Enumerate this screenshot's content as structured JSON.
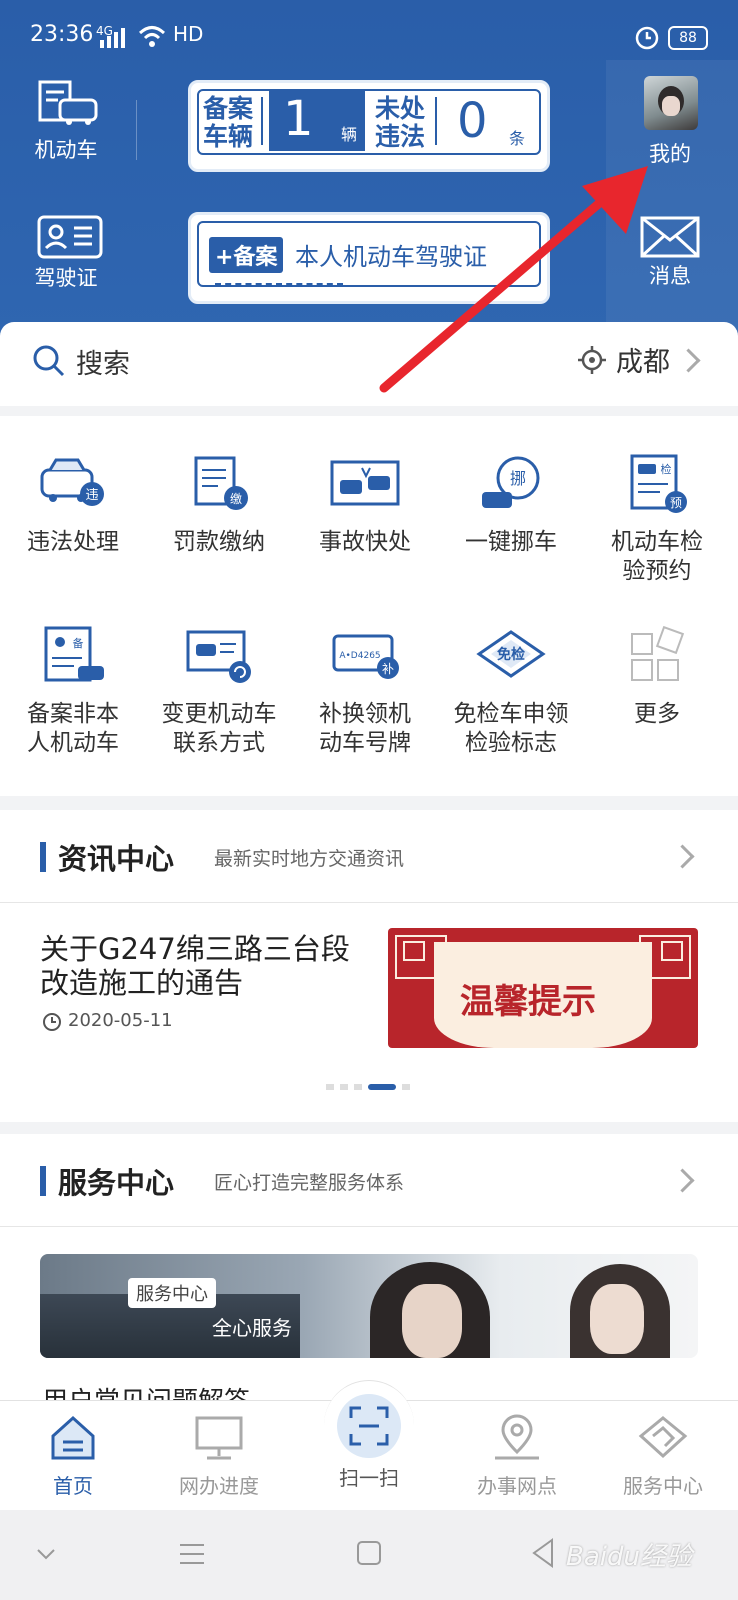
{
  "status_bar": {
    "time": "23:36",
    "network": "4G",
    "hd": "HD",
    "battery": "88"
  },
  "header": {
    "vehicle_label": "机动车",
    "license_label": "驾驶证",
    "mine_label": "我的",
    "message_label": "消息",
    "registered_vehicles": {
      "label_line1": "备案",
      "label_line2": "车辆",
      "count": "1",
      "unit": "辆"
    },
    "unhandled_violations": {
      "label_line1": "未处",
      "label_line2": "违法",
      "count": "0",
      "unit": "条"
    },
    "register_license": {
      "badge": "+备案",
      "text": "本人机动车驾驶证"
    }
  },
  "search": {
    "placeholder": "搜索",
    "city": "成都"
  },
  "services": [
    {
      "line1": "违法处理",
      "line2": "",
      "icon": "violation-car-icon"
    },
    {
      "line1": "罚款缴纳",
      "line2": "",
      "icon": "fine-payment-icon"
    },
    {
      "line1": "事故快处",
      "line2": "",
      "icon": "accident-icon"
    },
    {
      "line1": "一键挪车",
      "line2": "",
      "icon": "move-car-icon"
    },
    {
      "line1": "机动车检",
      "line2": "验预约",
      "icon": "inspection-booking-icon"
    },
    {
      "line1": "备案非本",
      "line2": "人机动车",
      "icon": "register-other-vehicle-icon"
    },
    {
      "line1": "变更机动车",
      "line2": "联系方式",
      "icon": "change-contact-icon"
    },
    {
      "line1": "补换领机",
      "line2": "动车号牌",
      "icon": "plate-replace-icon"
    },
    {
      "line1": "免检车申领",
      "line2": "检验标志",
      "icon": "exempt-inspection-icon"
    },
    {
      "line1": "更多",
      "line2": "",
      "icon": "more-icon"
    }
  ],
  "news": {
    "title": "资讯中心",
    "subtitle": "最新实时地方交通资讯",
    "article_title_line1": "关于G247绵三路三台段",
    "article_title_line2": "改造施工的通告",
    "date": "2020-05-11",
    "banner_text": "温馨提示",
    "plate_text": "A•D4265",
    "plate_badge": "补",
    "exempt_badge": "免检",
    "move_badge": "挪",
    "violation_badge": "违",
    "fine_badge": "缴",
    "inspect_badge": "检",
    "inspect_badge2": "预",
    "register_badge": "备"
  },
  "service_center": {
    "title": "服务中心",
    "subtitle": "匠心打造完整服务体系",
    "banner_tag": "服务中心",
    "banner_text": "全心服务",
    "faq_partial": "用户常见问题解答"
  },
  "tabs": [
    {
      "label": "首页",
      "icon": "home-icon"
    },
    {
      "label": "网办进度",
      "icon": "monitor-icon"
    },
    {
      "label": "扫一扫",
      "icon": "scan-icon"
    },
    {
      "label": "办事网点",
      "icon": "location-icon"
    },
    {
      "label": "服务中心",
      "icon": "handshake-icon"
    }
  ],
  "watermark": "Baidu经验"
}
